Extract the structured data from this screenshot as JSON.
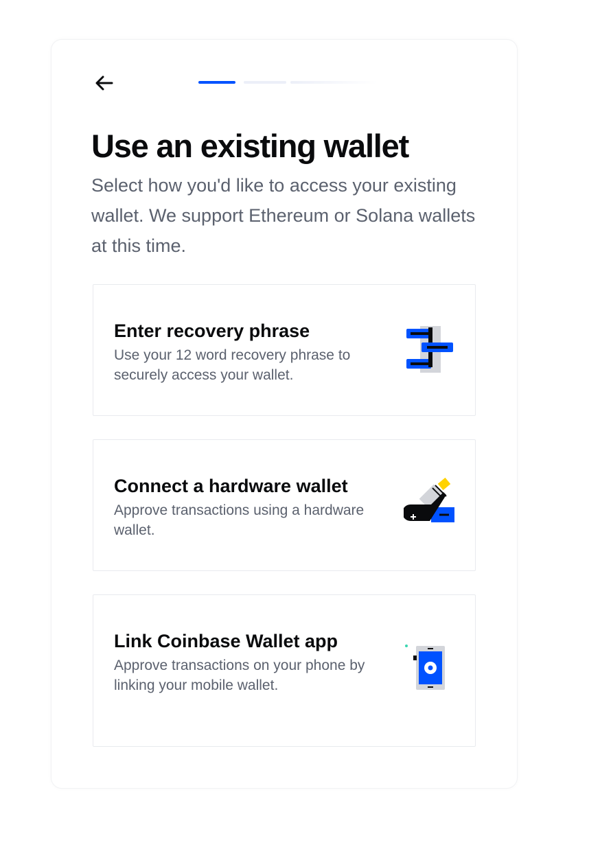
{
  "header": {
    "back_label": "Back",
    "progress": {
      "current_step": 1,
      "total_steps": 3
    }
  },
  "page": {
    "title": "Use an existing wallet",
    "subtitle": "Select how you'd like to access your existing wallet. We support Ethereum or Solana wallets at this time."
  },
  "options": [
    {
      "title": "Enter recovery phrase",
      "description": "Use your 12 word recovery phrase to securely access your wallet.",
      "icon": "recovery-phrase-icon"
    },
    {
      "title": "Connect a hardware wallet",
      "description": "Approve transactions using a hardware wallet.",
      "icon": "hardware-wallet-icon"
    },
    {
      "title": "Link Coinbase Wallet app",
      "description": "Approve transactions on your phone by linking your mobile wallet.",
      "icon": "mobile-wallet-icon"
    }
  ],
  "colors": {
    "accent": "#0052ff",
    "text_primary": "#0a0b0d",
    "text_secondary": "#5b616e",
    "border": "#e8eaee",
    "icon_yellow": "#ffd200"
  }
}
